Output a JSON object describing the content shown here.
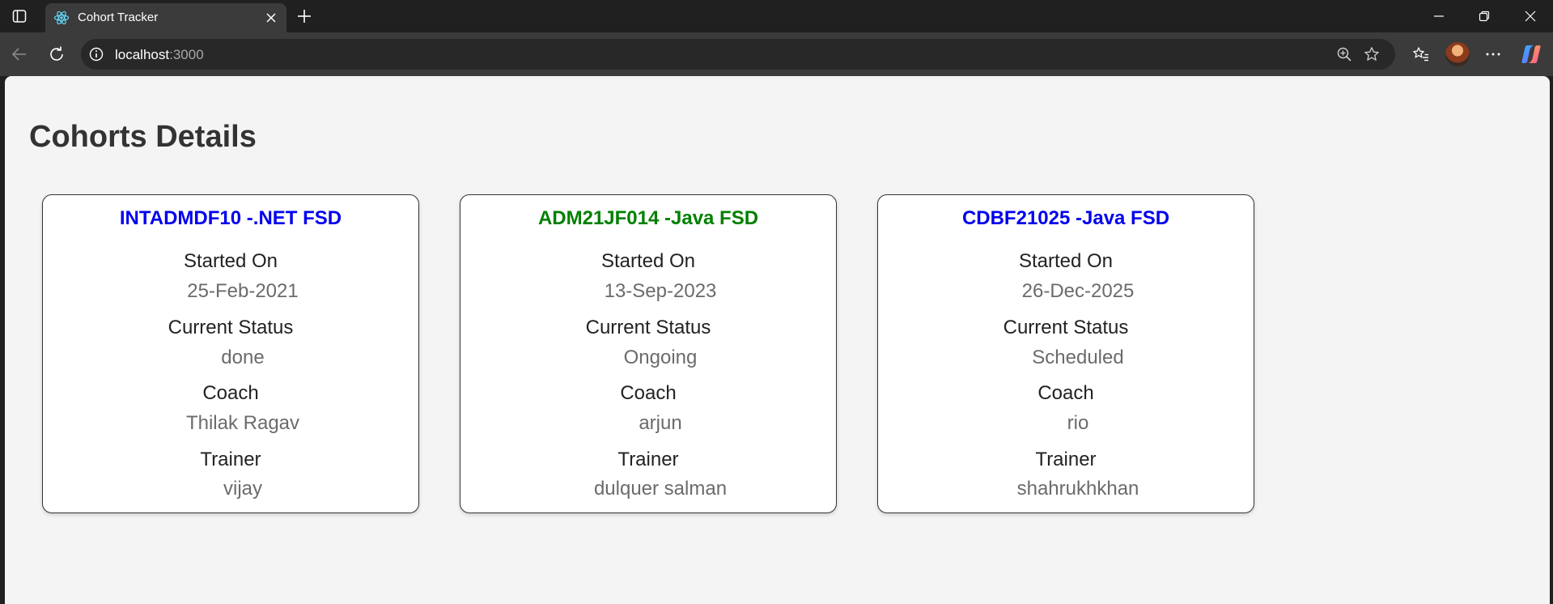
{
  "browser": {
    "tab": {
      "title": "Cohort Tracker"
    },
    "address_bar": {
      "host": "localhost",
      "port": ":3000"
    }
  },
  "page": {
    "title": "Cohorts Details",
    "cohorts": [
      {
        "title": "INTADMDF10 -.NET FSD",
        "title_color": "#0000ee",
        "started_label": "Started On",
        "started_value": "25-Feb-2021",
        "status_label": "Current Status",
        "status_value": "done",
        "coach_label": "Coach",
        "coach_value": "Thilak Ragav",
        "trainer_label": "Trainer",
        "trainer_value": "vijay"
      },
      {
        "title": "ADM21JF014 -Java FSD",
        "title_color": "#008000",
        "started_label": "Started On",
        "started_value": "13-Sep-2023",
        "status_label": "Current Status",
        "status_value": "Ongoing",
        "coach_label": "Coach",
        "coach_value": "arjun",
        "trainer_label": "Trainer",
        "trainer_value": "dulquer salman"
      },
      {
        "title": "CDBF21025 -Java FSD",
        "title_color": "#0000ee",
        "started_label": "Started On",
        "started_value": "26-Dec-2025",
        "status_label": "Current Status",
        "status_value": "Scheduled",
        "coach_label": "Coach",
        "coach_value": "rio",
        "trainer_label": "Trainer",
        "trainer_value": "shahrukhkhan"
      }
    ]
  },
  "colors": {
    "chrome_dark": "#202020",
    "chrome_toolbar": "#3b3b3b",
    "page_background": "#f4f4f4",
    "card_background": "#ffffff",
    "label_text": "#222222",
    "value_text": "#6b6b6b"
  },
  "icons": {
    "sidebar_toggle": "sidebar-icon",
    "tab_favicon": "react-logo-icon",
    "tab_close": "close-icon",
    "new_tab": "plus-icon",
    "back": "back-arrow-icon",
    "reload": "reload-icon",
    "site_info": "info-icon",
    "zoom": "zoom-icon",
    "favorite": "star-icon",
    "favorites": "favorites-icon",
    "more": "more-icon",
    "copilot": "copilot-icon"
  }
}
